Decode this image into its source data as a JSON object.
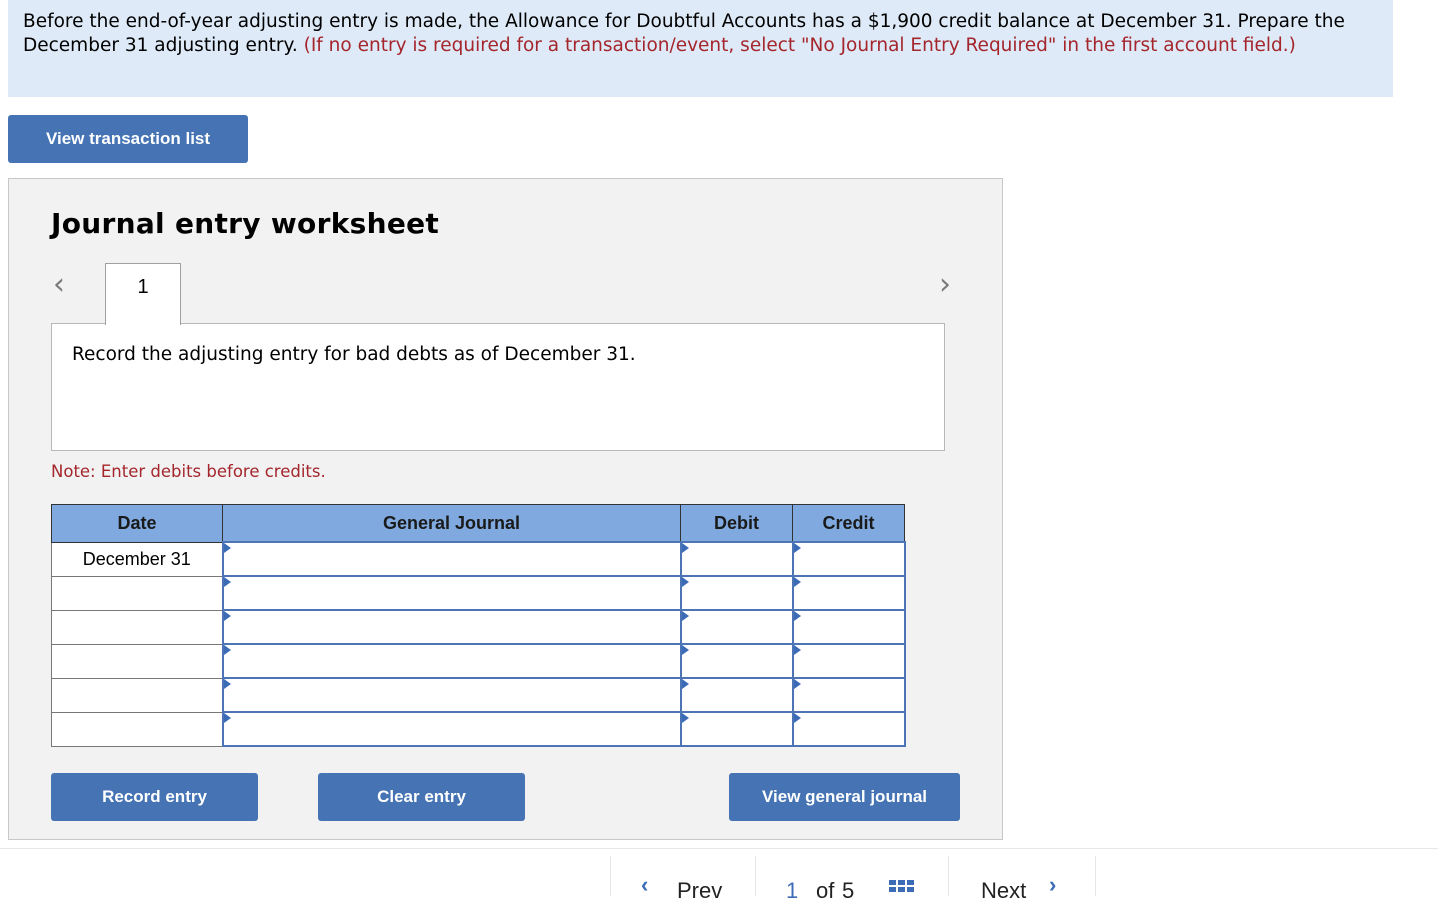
{
  "prompt": {
    "text_main": "Before the end-of-year adjusting entry is made, the Allowance for Doubtful Accounts has a $1,900 credit balance at December 31. Prepare the December 31 adjusting entry.",
    "text_instruction": "(If no entry is required for a transaction/event, select \"No Journal Entry Required\" in the first account field.)"
  },
  "view_transaction_list_label": "View transaction list",
  "worksheet": {
    "title": "Journal entry worksheet",
    "tabs": [
      {
        "label": "1"
      }
    ],
    "instruction": "Record the adjusting entry for bad debts as of December 31.",
    "note": "Note: Enter debits before credits.",
    "columns": [
      "Date",
      "General Journal",
      "Debit",
      "Credit"
    ],
    "rows": [
      {
        "date": "December 31",
        "account": "",
        "debit": "",
        "credit": ""
      },
      {
        "date": "",
        "account": "",
        "debit": "",
        "credit": ""
      },
      {
        "date": "",
        "account": "",
        "debit": "",
        "credit": ""
      },
      {
        "date": "",
        "account": "",
        "debit": "",
        "credit": ""
      },
      {
        "date": "",
        "account": "",
        "debit": "",
        "credit": ""
      },
      {
        "date": "",
        "account": "",
        "debit": "",
        "credit": ""
      }
    ],
    "buttons": {
      "record": "Record entry",
      "clear": "Clear entry",
      "view_journal": "View general journal"
    }
  },
  "pager": {
    "prev": "Prev",
    "current": "1",
    "of": "of",
    "total": "5",
    "next": "Next"
  }
}
